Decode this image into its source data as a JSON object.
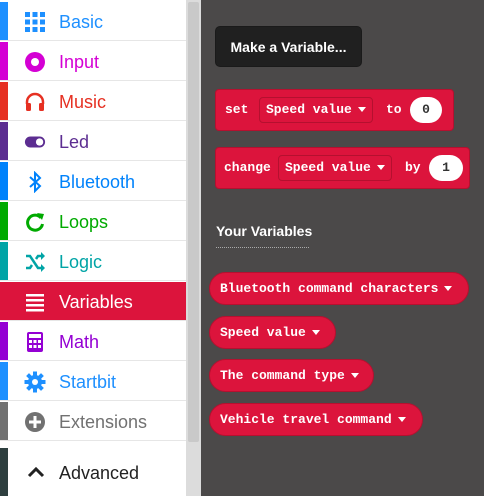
{
  "toolbox": {
    "categories": [
      {
        "label": "Basic",
        "color": "#1e90ff",
        "icon": "grid-icon"
      },
      {
        "label": "Input",
        "color": "#d400d4",
        "icon": "radio-circle-icon"
      },
      {
        "label": "Music",
        "color": "#e63022",
        "icon": "headphones-icon"
      },
      {
        "label": "Led",
        "color": "#5c2d91",
        "icon": "toggle-icon"
      },
      {
        "label": "Bluetooth",
        "color": "#0082fb",
        "icon": "bluetooth-icon"
      },
      {
        "label": "Loops",
        "color": "#00aa00",
        "icon": "loop-arrow-icon"
      },
      {
        "label": "Logic",
        "color": "#00a4a6",
        "icon": "shuffle-icon"
      },
      {
        "label": "Variables",
        "color": "#dc143c",
        "icon": "list-lines-icon"
      },
      {
        "label": "Math",
        "color": "#9400d3",
        "icon": "calculator-icon"
      },
      {
        "label": "Startbit",
        "color": "#1e90ff",
        "icon": "gear-icon"
      },
      {
        "label": "Extensions",
        "color": "#717171",
        "icon": "plus-circle-icon"
      }
    ],
    "selected": "Variables",
    "advanced_label": "Advanced"
  },
  "flyout": {
    "make_variable_label": "Make a Variable...",
    "set_block": {
      "kw_set": "set",
      "variable": "Speed value",
      "kw_to": "to",
      "value": "0"
    },
    "change_block": {
      "kw_change": "change",
      "variable": "Speed value",
      "kw_by": "by",
      "value": "1"
    },
    "your_variables_heading": "Your Variables",
    "variables": [
      "Bluetooth command characters",
      "Speed value",
      "The command type",
      "Vehicle travel command"
    ]
  }
}
